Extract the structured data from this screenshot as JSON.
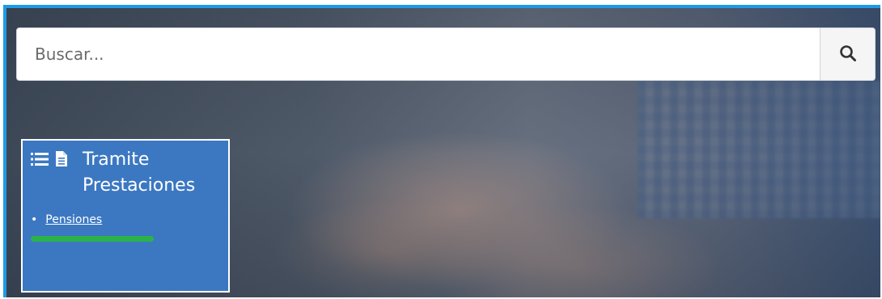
{
  "search": {
    "placeholder": "Buscar..."
  },
  "icons": {
    "search": "search-icon",
    "list": "list-icon",
    "document": "document-icon"
  },
  "card": {
    "title_line1": "Tramite",
    "title_line2": "Prestaciones",
    "links": [
      {
        "label": "Pensiones"
      }
    ]
  },
  "colors": {
    "frame_border": "#1e9be4",
    "card_background": "#3c78c2",
    "highlight": "#2bb34a"
  }
}
